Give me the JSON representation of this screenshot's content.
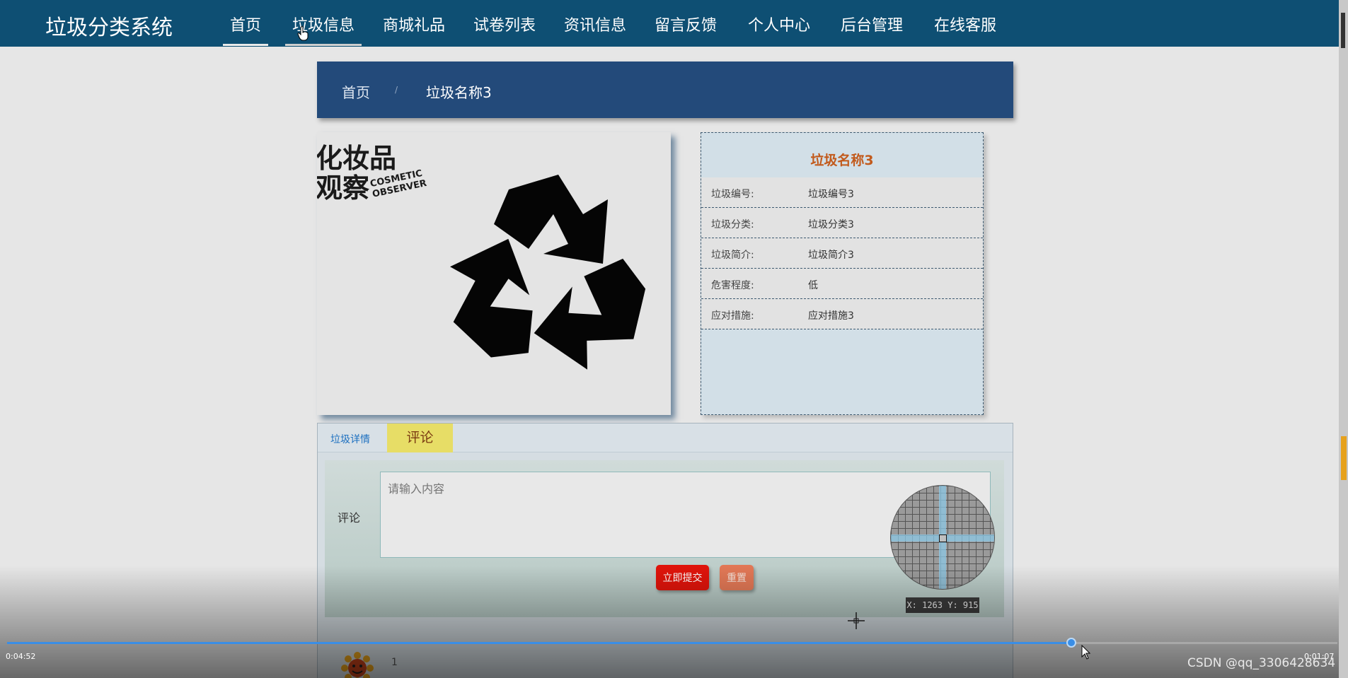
{
  "nav": {
    "brand": "垃圾分类系统",
    "items": [
      {
        "label": "首页"
      },
      {
        "label": "垃圾信息"
      },
      {
        "label": "商城礼品"
      },
      {
        "label": "试卷列表"
      },
      {
        "label": "资讯信息"
      },
      {
        "label": "留言反馈"
      },
      {
        "label": "个人中心"
      },
      {
        "label": "后台管理"
      },
      {
        "label": "在线客服"
      }
    ]
  },
  "breadcrumb": {
    "home": "首页",
    "separator": "/",
    "current": "垃圾名称3"
  },
  "image": {
    "icon": "recycle-icon",
    "watermark_cn_line1": "化妆品",
    "watermark_cn_line2": "观察",
    "watermark_en_line1": "COSMETIC",
    "watermark_en_line2": "OBSERVER"
  },
  "detail": {
    "title": "垃圾名称3",
    "rows": [
      {
        "label": "垃圾编号:",
        "value": "垃圾编号3"
      },
      {
        "label": "垃圾分类:",
        "value": "垃圾分类3"
      },
      {
        "label": "垃圾简介:",
        "value": "垃圾简介3"
      },
      {
        "label": "危害程度:",
        "value": "低"
      },
      {
        "label": "应对措施:",
        "value": "应对措施3"
      }
    ]
  },
  "tabs": {
    "detail": "垃圾详情",
    "comment": "评论"
  },
  "comment_form": {
    "label": "评论",
    "placeholder": "请输入内容",
    "submit": "立即提交",
    "reset": "重置"
  },
  "comment_list": [
    {
      "avatar": "sunflower-avatar",
      "text": "1"
    }
  ],
  "magnifier": {
    "coords": "X: 1263 Y: 915"
  },
  "player": {
    "current_time": "0:04:52",
    "total_time": "0:01:07",
    "progress": 0.8,
    "watermark": "CSDN @qq_3306428634"
  },
  "colors": {
    "nav_bg": "#0e4f73",
    "breadcrumb_bg": "#234a7a",
    "title_accent": "#c25a1c",
    "submit_bg": "#e0140b",
    "reset_bg": "#e27856",
    "comment_tab_bg": "#e7dd66",
    "progress": "#3a8ee6"
  }
}
